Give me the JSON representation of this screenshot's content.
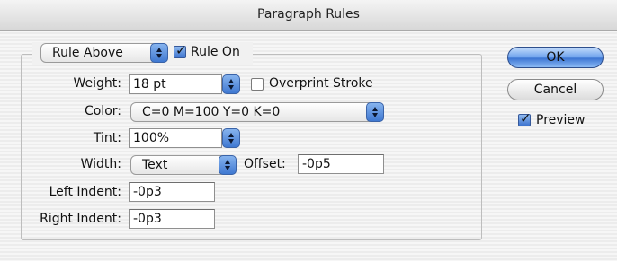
{
  "window": {
    "title": "Paragraph Rules"
  },
  "rule_type": {
    "selected": "Rule Above"
  },
  "rule_on": {
    "label": "Rule On",
    "checked": true
  },
  "weight": {
    "label": "Weight:",
    "value": "18 pt"
  },
  "overprint_stroke": {
    "label": "Overprint Stroke",
    "checked": false
  },
  "color": {
    "label": "Color:",
    "selected": "C=0 M=100 Y=0 K=0"
  },
  "tint": {
    "label": "Tint:",
    "value": "100%"
  },
  "width": {
    "label": "Width:",
    "selected": "Text"
  },
  "offset": {
    "label": "Offset:",
    "value": "-0p5"
  },
  "left_indent": {
    "label": "Left Indent:",
    "value": "-0p3"
  },
  "right_indent": {
    "label": "Right Indent:",
    "value": "-0p3"
  },
  "buttons": {
    "ok": "OK",
    "cancel": "Cancel"
  },
  "preview": {
    "label": "Preview",
    "checked": true
  },
  "colors": {
    "accent": "#3d76d3"
  }
}
